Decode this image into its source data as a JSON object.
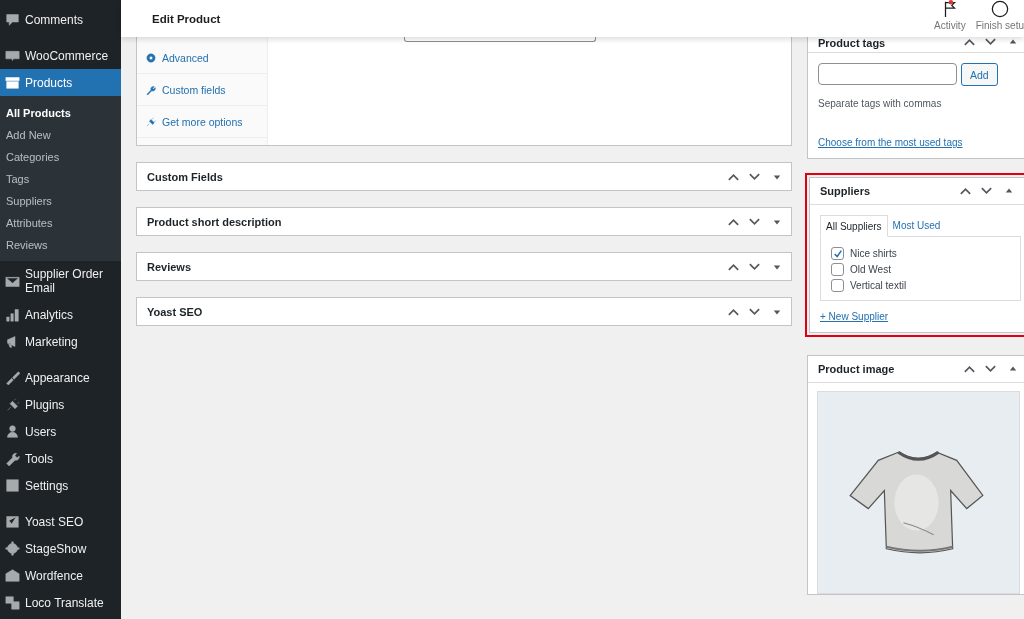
{
  "sidebar": {
    "groups": [
      {
        "items": [
          {
            "label": "Comments",
            "selected": false
          }
        ]
      },
      {
        "items": [
          {
            "label": "WooCommerce",
            "selected": false
          },
          {
            "label": "Products",
            "selected": true,
            "submenu": [
              {
                "label": "All Products",
                "selected": true
              },
              {
                "label": "Add New",
                "selected": false
              },
              {
                "label": "Categories",
                "selected": false
              },
              {
                "label": "Tags",
                "selected": false
              },
              {
                "label": "Suppliers",
                "selected": false
              },
              {
                "label": "Attributes",
                "selected": false
              },
              {
                "label": "Reviews",
                "selected": false
              }
            ]
          },
          {
            "label": "Supplier Order Email",
            "selected": false
          },
          {
            "label": "Analytics",
            "selected": false
          },
          {
            "label": "Marketing",
            "selected": false
          }
        ]
      },
      {
        "items": [
          {
            "label": "Appearance",
            "selected": false
          },
          {
            "label": "Plugins",
            "selected": false
          },
          {
            "label": "Users",
            "selected": false
          },
          {
            "label": "Tools",
            "selected": false
          },
          {
            "label": "Settings",
            "selected": false
          }
        ]
      },
      {
        "items": [
          {
            "label": "Yoast SEO",
            "selected": false
          },
          {
            "label": "StageShow",
            "selected": false
          },
          {
            "label": "Wordfence",
            "selected": false
          },
          {
            "label": "Loco Translate",
            "selected": false
          }
        ]
      }
    ]
  },
  "header": {
    "title": "Edit Product",
    "actions": [
      {
        "label": "Activity",
        "kind": "flag",
        "notification": true
      },
      {
        "label": "Finish setu",
        "kind": "ring",
        "notification": false
      }
    ]
  },
  "product_data": {
    "tabs": [
      {
        "label": "Advanced"
      },
      {
        "label": "Custom fields"
      },
      {
        "label": "Get more options"
      }
    ]
  },
  "boxes": [
    {
      "title": "Custom Fields"
    },
    {
      "title": "Product short description"
    },
    {
      "title": "Reviews"
    },
    {
      "title": "Yoast SEO"
    }
  ],
  "product_tags": {
    "title": "Product tags",
    "button": "Add",
    "hint": "Separate tags with commas",
    "link": "Choose from the most used tags"
  },
  "suppliers": {
    "title": "Suppliers",
    "highlighted": true,
    "tabs": [
      {
        "label": "All Suppliers",
        "selected": true
      },
      {
        "label": "Most Used",
        "selected": false
      }
    ],
    "items": [
      {
        "label": "Nice shirts",
        "checked": true
      },
      {
        "label": "Old West",
        "checked": false
      },
      {
        "label": "Vertical textil",
        "checked": false
      }
    ],
    "link": "+ New Supplier"
  },
  "product_image": {
    "title": "Product image"
  }
}
